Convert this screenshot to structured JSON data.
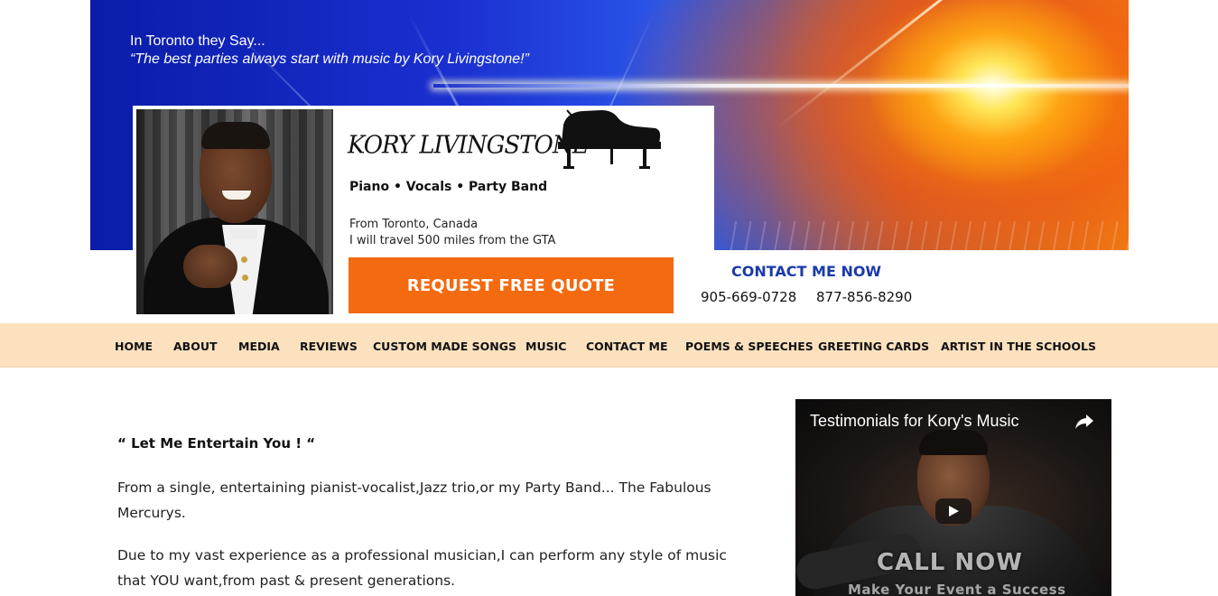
{
  "banner": {
    "line1": "In Toronto they Say...",
    "line2": "“The best parties always start with music by Kory Livingstone!”"
  },
  "brand": {
    "logo_text": "KORY LIVINGSTONE",
    "tagline": "Piano • Vocals • Party Band",
    "origin_line1": "From Toronto, Canada",
    "origin_line2": "I will travel 500 miles from the GTA"
  },
  "cta": {
    "quote_label": "REQUEST FREE QUOTE",
    "contact_title": "CONTACT ME NOW",
    "phone1": "905-669-0728",
    "phone2": "877-856-8290"
  },
  "nav": {
    "items": [
      {
        "label": "HOME"
      },
      {
        "label": "ABOUT"
      },
      {
        "label": "MEDIA"
      },
      {
        "label": "REVIEWS"
      },
      {
        "label": "CUSTOM MADE SONGS"
      },
      {
        "label": "MUSIC"
      },
      {
        "label": "CONTACT ME"
      },
      {
        "label": "POEMS & SPEECHES"
      },
      {
        "label": "GREETING CARDS"
      },
      {
        "label": "ARTIST IN THE SCHOOLS"
      }
    ]
  },
  "main": {
    "headline": "“ Let Me Entertain You ! “",
    "para1": "From a single, entertaining pianist-vocalist,Jazz trio,or my Party Band... The Fabulous Mercurys.",
    "para2": "Due to my vast experience as a professional musician,I can perform any style of music that YOU want,from past & present generations."
  },
  "video": {
    "title": "Testimonials for Kory's Music",
    "overlay_line1": "CALL NOW",
    "overlay_line2": "Make Your Event a Success"
  },
  "icons": {
    "share": "share-icon",
    "play": "play-icon",
    "piano": "grand-piano-icon"
  },
  "colors": {
    "accent_orange": "#f46a10",
    "nav_bg": "#fce1bf",
    "contact_blue": "#1a3aa8"
  }
}
